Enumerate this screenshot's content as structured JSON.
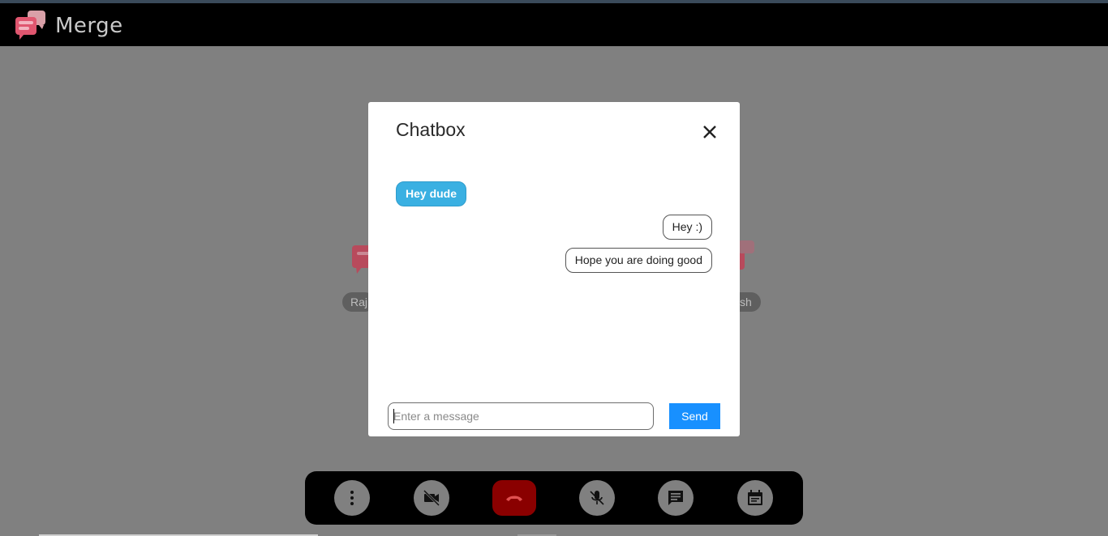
{
  "app": {
    "brand": "Merge",
    "logo_icon": "chat-bubbles-logo"
  },
  "participants": [
    {
      "name_visible": "Raj"
    },
    {
      "name_visible": "sh"
    }
  ],
  "chatbox": {
    "title": "Chatbox",
    "close_icon": "close-icon",
    "messages": [
      {
        "text": "Hey dude",
        "direction": "incoming"
      },
      {
        "text": "Hey :)",
        "direction": "outgoing"
      },
      {
        "text": "Hope you are doing good",
        "direction": "outgoing"
      }
    ],
    "input": {
      "value": "",
      "placeholder": "Enter a message"
    },
    "send_label": "Send"
  },
  "controls": [
    {
      "icon": "more-vert-icon"
    },
    {
      "icon": "video-off-icon"
    },
    {
      "icon": "end-call-icon"
    },
    {
      "icon": "mic-off-icon"
    },
    {
      "icon": "chat-icon"
    },
    {
      "icon": "calendar-icon"
    }
  ],
  "colors": {
    "incoming_bubble": "#3ab0e2",
    "send_button": "#1890ff",
    "end_call": "#8a0000",
    "header": "#000000"
  }
}
